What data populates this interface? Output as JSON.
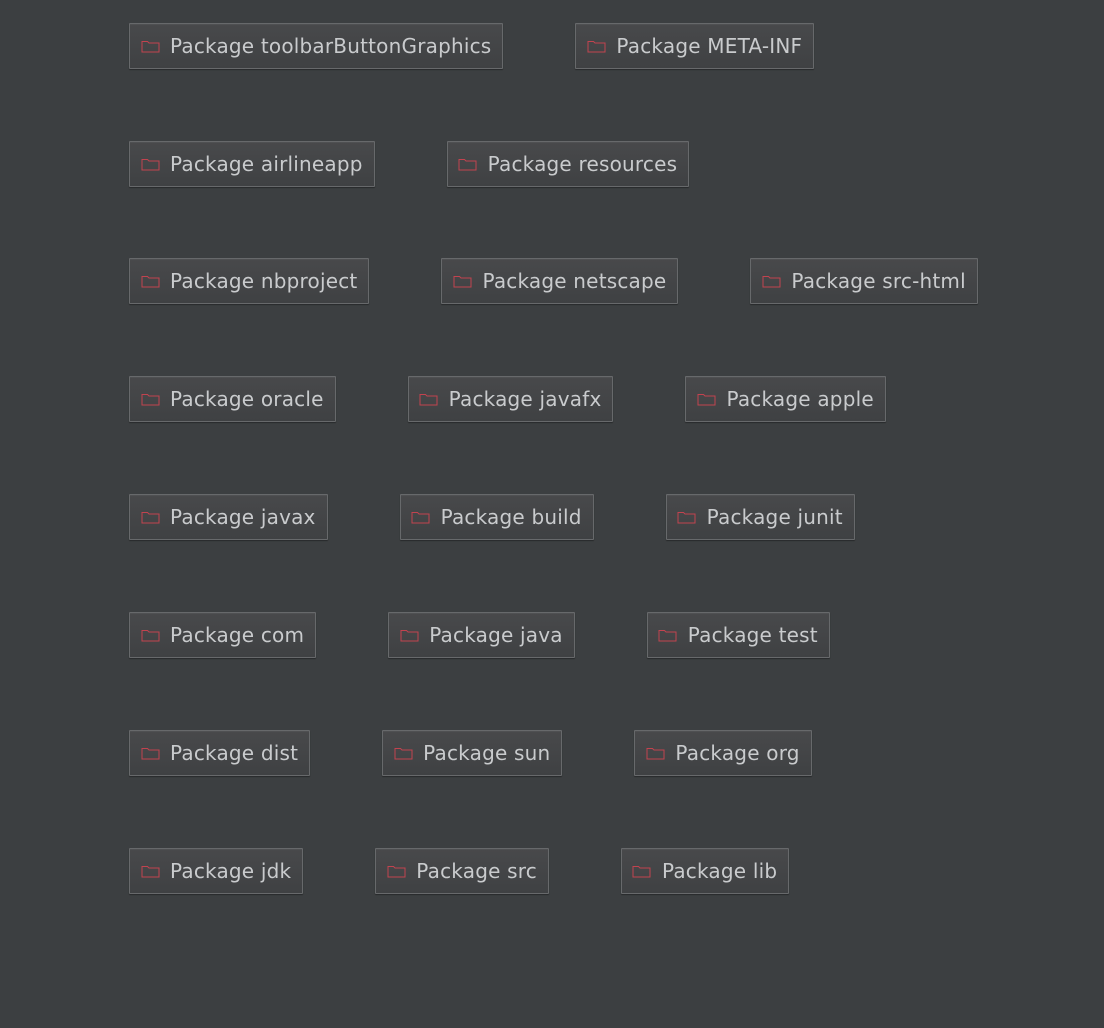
{
  "diagram": {
    "icon": "folder-icon",
    "colors": {
      "background": "#3c3f41",
      "node_fill": "#45474a",
      "node_border": "#67696b",
      "label_text": "#c9cbcd",
      "icon_stroke": "#c2434f"
    },
    "rows": [
      {
        "nodes": [
          {
            "label": "Package toolbarButtonGraphics"
          },
          {
            "label": "Package META-INF"
          }
        ]
      },
      {
        "nodes": [
          {
            "label": "Package airlineapp"
          },
          {
            "label": "Package resources"
          }
        ]
      },
      {
        "nodes": [
          {
            "label": "Package nbproject"
          },
          {
            "label": "Package netscape"
          },
          {
            "label": "Package src-html"
          }
        ]
      },
      {
        "nodes": [
          {
            "label": "Package oracle"
          },
          {
            "label": "Package javafx"
          },
          {
            "label": "Package apple"
          }
        ]
      },
      {
        "nodes": [
          {
            "label": "Package javax"
          },
          {
            "label": "Package build"
          },
          {
            "label": "Package junit"
          }
        ]
      },
      {
        "nodes": [
          {
            "label": "Package com"
          },
          {
            "label": "Package java"
          },
          {
            "label": "Package test"
          }
        ]
      },
      {
        "nodes": [
          {
            "label": "Package dist"
          },
          {
            "label": "Package sun"
          },
          {
            "label": "Package org"
          }
        ]
      },
      {
        "nodes": [
          {
            "label": "Package jdk"
          },
          {
            "label": "Package src"
          },
          {
            "label": "Package lib"
          }
        ]
      }
    ]
  }
}
